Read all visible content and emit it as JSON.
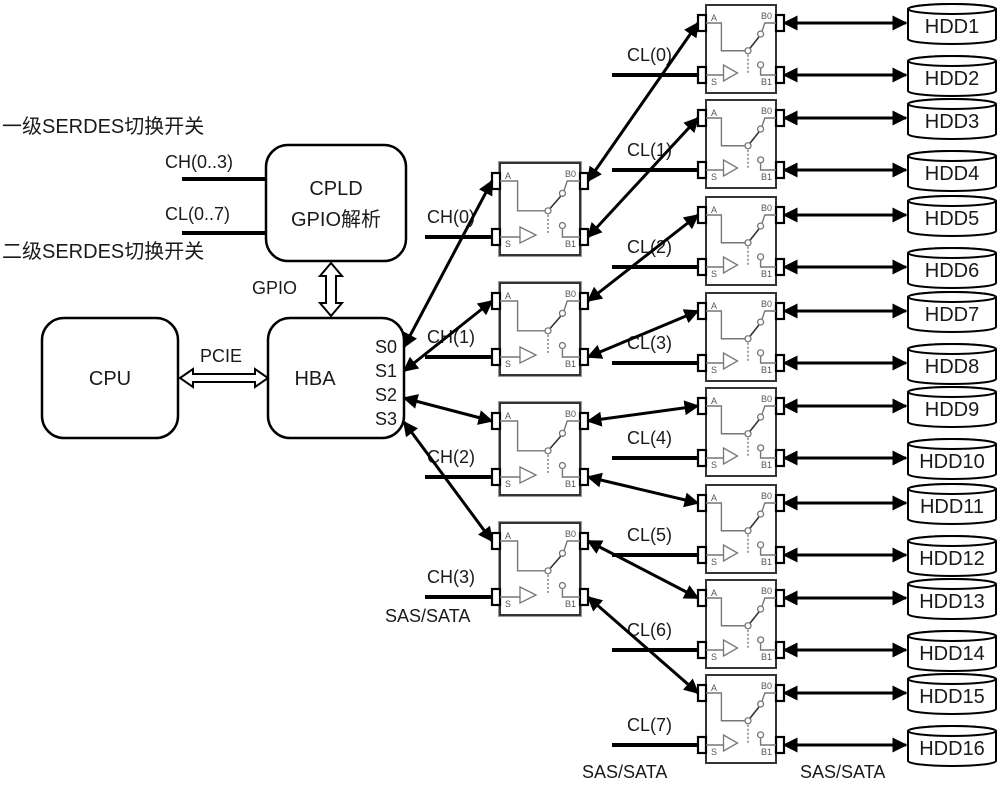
{
  "labels": {
    "level1_switch": "一级SERDES切换开关",
    "level2_switch": "二级SERDES切换开关",
    "ch_bus": "CH(0..3)",
    "cl_bus": "CL(0..7)",
    "gpio": "GPIO",
    "pcie": "PCIE",
    "sas_sata_left": "SAS/SATA",
    "sas_sata_mid": "SAS/SATA",
    "sas_sata_right": "SAS/SATA"
  },
  "blocks": {
    "cpu": "CPU",
    "hba": "HBA",
    "cpld_line1": "CPLD",
    "cpld_line2": "GPIO解析"
  },
  "hba_ports": [
    "S0",
    "S1",
    "S2",
    "S3"
  ],
  "switch_pins": {
    "a": "A",
    "s": "S",
    "b0": "B0",
    "b1": "B1"
  },
  "level1_switches": [
    {
      "ctrl": "CH(0)"
    },
    {
      "ctrl": "CH(1)"
    },
    {
      "ctrl": "CH(2)"
    },
    {
      "ctrl": "CH(3)"
    }
  ],
  "level2_switches": [
    {
      "ctrl": "CL(0)"
    },
    {
      "ctrl": "CL(1)"
    },
    {
      "ctrl": "CL(2)"
    },
    {
      "ctrl": "CL(3)"
    },
    {
      "ctrl": "CL(4)"
    },
    {
      "ctrl": "CL(5)"
    },
    {
      "ctrl": "CL(6)"
    },
    {
      "ctrl": "CL(7)"
    }
  ],
  "hdds": [
    "HDD1",
    "HDD2",
    "HDD3",
    "HDD4",
    "HDD5",
    "HDD6",
    "HDD7",
    "HDD8",
    "HDD9",
    "HDD10",
    "HDD11",
    "HDD12",
    "HDD13",
    "HDD14",
    "HDD15",
    "HDD16"
  ]
}
